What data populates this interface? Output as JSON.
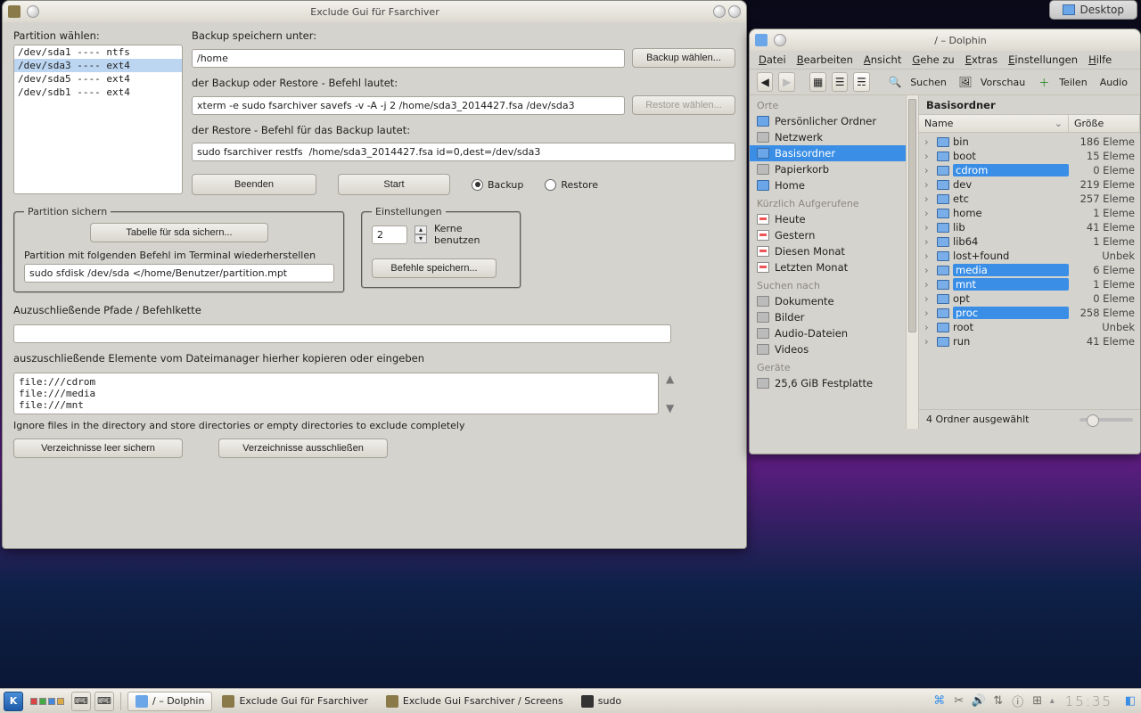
{
  "desktop_button": "Desktop",
  "fsa": {
    "title": "Exclude Gui für Fsarchiver",
    "partition_label": "Partition wählen:",
    "partitions": [
      "/dev/sda1  ----  ntfs",
      "/dev/sda3  ----  ext4",
      "/dev/sda5  ----  ext4",
      "/dev/sdb1  ----  ext4"
    ],
    "partition_selected_index": 1,
    "save_label": "Backup speichern unter:",
    "save_value": "/home",
    "save_btn": "Backup wählen...",
    "cmd_label": "der Backup oder Restore - Befehl lautet:",
    "cmd_value": "xterm -e sudo fsarchiver savefs -v -A -j 2 /home/sda3_2014427.fsa /dev/sda3",
    "restore_btn": "Restore wählen...",
    "restorecmd_label": "der Restore - Befehl für das Backup lautet:",
    "restorecmd_value": "sudo fsarchiver restfs  /home/sda3_2014427.fsa id=0,dest=/dev/sda3",
    "quit_btn": "Beenden",
    "start_btn": "Start",
    "radio_backup": "Backup",
    "radio_restore": "Restore",
    "radio_sel": "backup",
    "partsave_legend": "Partition sichern",
    "partsave_btn": "Tabelle für sda sichern...",
    "partrestore_label": "Partition mit folgenden Befehl im Terminal wiederherstellen",
    "partrestore_value": "sudo sfdisk /dev/sda </home/Benutzer/partition.mpt",
    "settings_legend": "Einstellungen",
    "cores_value": "2",
    "cores_label": "Kerne benutzen",
    "savecmds_btn": "Befehle speichern...",
    "excludepath_label": "Auzuschließende Pfade / Befehlkette",
    "excludepath_value": "",
    "excludehint": "auszuschließende Elemente vom Dateimanager hierher kopieren oder eingeben",
    "excludelist": "file:///cdrom\nfile:///media\nfile:///mnt",
    "ignorehint": "Ignore files in the directory and store directories or empty directories to exclude completely",
    "emptydirs_btn": "Verzeichnisse leer sichern",
    "excludedirs_btn": "Verzeichnisse ausschließen"
  },
  "dolphin": {
    "title": "/ – Dolphin",
    "menus": [
      "Datei",
      "Bearbeiten",
      "Ansicht",
      "Gehe zu",
      "Extras",
      "Einstellungen",
      "Hilfe"
    ],
    "tb_search": "Suchen",
    "tb_preview": "Vorschau",
    "tb_share": "Teilen",
    "tb_audio": "Audio",
    "places_hdr": "Orte",
    "places": [
      {
        "name": "Persönlicher Ordner",
        "ico": "blue"
      },
      {
        "name": "Netzwerk",
        "ico": "grey"
      },
      {
        "name": "Basisordner",
        "ico": "blue",
        "sel": true
      },
      {
        "name": "Papierkorb",
        "ico": "grey"
      },
      {
        "name": "Home",
        "ico": "blue"
      }
    ],
    "recent_hdr": "Kürzlich Aufgerufene",
    "recent": [
      "Heute",
      "Gestern",
      "Diesen Monat",
      "Letzten Monat"
    ],
    "search_hdr": "Suchen nach",
    "search_items": [
      "Dokumente",
      "Bilder",
      "Audio-Dateien",
      "Videos"
    ],
    "devices_hdr": "Geräte",
    "device": "25,6 GiB Festplatte",
    "path_header": "Basisordner",
    "col_name": "Name",
    "col_size": "Größe",
    "tree": [
      {
        "n": "bin",
        "s": "186 Eleme"
      },
      {
        "n": "boot",
        "s": "15 Eleme"
      },
      {
        "n": "cdrom",
        "s": "0 Eleme",
        "sel": true
      },
      {
        "n": "dev",
        "s": "219 Eleme"
      },
      {
        "n": "etc",
        "s": "257 Eleme"
      },
      {
        "n": "home",
        "s": "1 Eleme"
      },
      {
        "n": "lib",
        "s": "41 Eleme"
      },
      {
        "n": "lib64",
        "s": "1 Eleme"
      },
      {
        "n": "lost+found",
        "s": "Unbek"
      },
      {
        "n": "media",
        "s": "6 Eleme",
        "sel": true
      },
      {
        "n": "mnt",
        "s": "1 Eleme",
        "sel": true
      },
      {
        "n": "opt",
        "s": "0 Eleme"
      },
      {
        "n": "proc",
        "s": "258 Eleme",
        "sel": true
      },
      {
        "n": "root",
        "s": "Unbek"
      },
      {
        "n": "run",
        "s": "41 Eleme"
      }
    ],
    "status": "4 Ordner ausgewählt"
  },
  "taskbar": {
    "tasks": [
      {
        "label": "/ – Dolphin",
        "active": true,
        "color": "#6aa6e8"
      },
      {
        "label": "Exclude Gui für Fsarchiver",
        "color": "#8a7a4a"
      },
      {
        "label": "Exclude Gui Fsarchiver / Screens",
        "color": "#8a7a4a"
      },
      {
        "label": "sudo",
        "color": "#333"
      }
    ],
    "clock": "15:35"
  }
}
